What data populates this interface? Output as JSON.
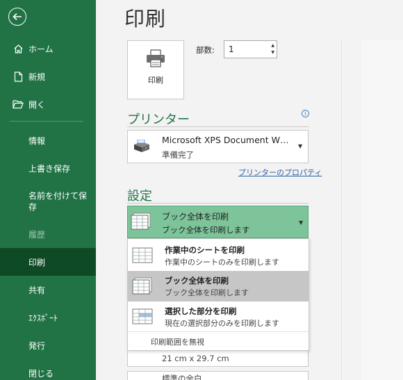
{
  "sidebar": {
    "nav_top": [
      {
        "label": "ホーム",
        "icon": "home-icon"
      },
      {
        "label": "新規",
        "icon": "new-document-icon"
      },
      {
        "label": "開く",
        "icon": "open-folder-icon"
      }
    ],
    "nav_bottom": [
      {
        "label": "情報"
      },
      {
        "label": "上書き保存"
      },
      {
        "label": "名前を付けて保存"
      },
      {
        "label": "履歴"
      },
      {
        "label": "印刷"
      },
      {
        "label": "共有"
      },
      {
        "label": "ｴｸｽﾎﾟｰﾄ"
      },
      {
        "label": "発行"
      },
      {
        "label": "閉じる"
      }
    ]
  },
  "main": {
    "title": "印刷",
    "print_button_label": "印刷",
    "copies_label": "部数:",
    "copies_value": "1",
    "printer_heading": "プリンター",
    "printer_name": "Microsoft XPS Document W…",
    "printer_status": "準備完了",
    "printer_properties_link": "プリンターのプロパティ",
    "settings_heading": "設定",
    "selected_setting": {
      "title": "ブック全体を印刷",
      "subtitle": "ブック全体を印刷します"
    },
    "dropdown_options": [
      {
        "title": "作業中のシートを印刷",
        "subtitle": "作業中のシートのみを印刷します"
      },
      {
        "title": "ブック全体を印刷",
        "subtitle": "ブック全体を印刷します"
      },
      {
        "title": "選択した部分を印刷",
        "subtitle": "現在の選択部分のみを印刷します"
      }
    ],
    "ignore_print_area": "印刷範囲を無視",
    "paper_size": "21 cm x 29.7 cm",
    "margins": "標準の余白"
  },
  "colors": {
    "sidebar_bg": "#217346",
    "sidebar_active": "#0f4a26",
    "accent": "#217346",
    "selected_setting_bg": "#7dc49a",
    "link": "#2b5fa8"
  }
}
